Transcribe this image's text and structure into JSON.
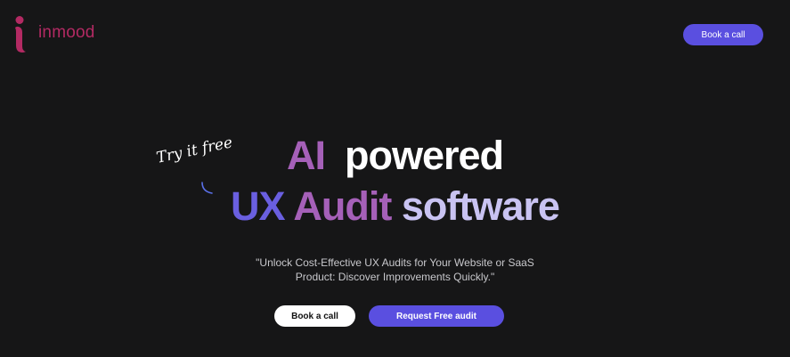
{
  "brand": {
    "name": "inmood",
    "color": "#b32a63"
  },
  "header": {
    "cta_label": "Book a call"
  },
  "hero": {
    "try_label": "Try it free",
    "headline_line1": {
      "word1": "AI",
      "word2": "powered"
    },
    "headline_line2": {
      "word1": "UX",
      "word2": "Audit",
      "word3": "software"
    },
    "subtitle_line1": "\"Unlock Cost-Effective UX Audits for Your Website or SaaS",
    "subtitle_line2": "Product: Discover Improvements Quickly.\"",
    "primary_button": "Book a call",
    "secondary_button": "Request Free audit"
  },
  "colors": {
    "background": "#161617",
    "accent": "#5a4fe0",
    "purple": "#a560b8",
    "lavender": "#c9c3f2"
  },
  "icons": {
    "logo": "inmood-logo-mark",
    "swoosh": "curved-arrow-swoosh"
  }
}
